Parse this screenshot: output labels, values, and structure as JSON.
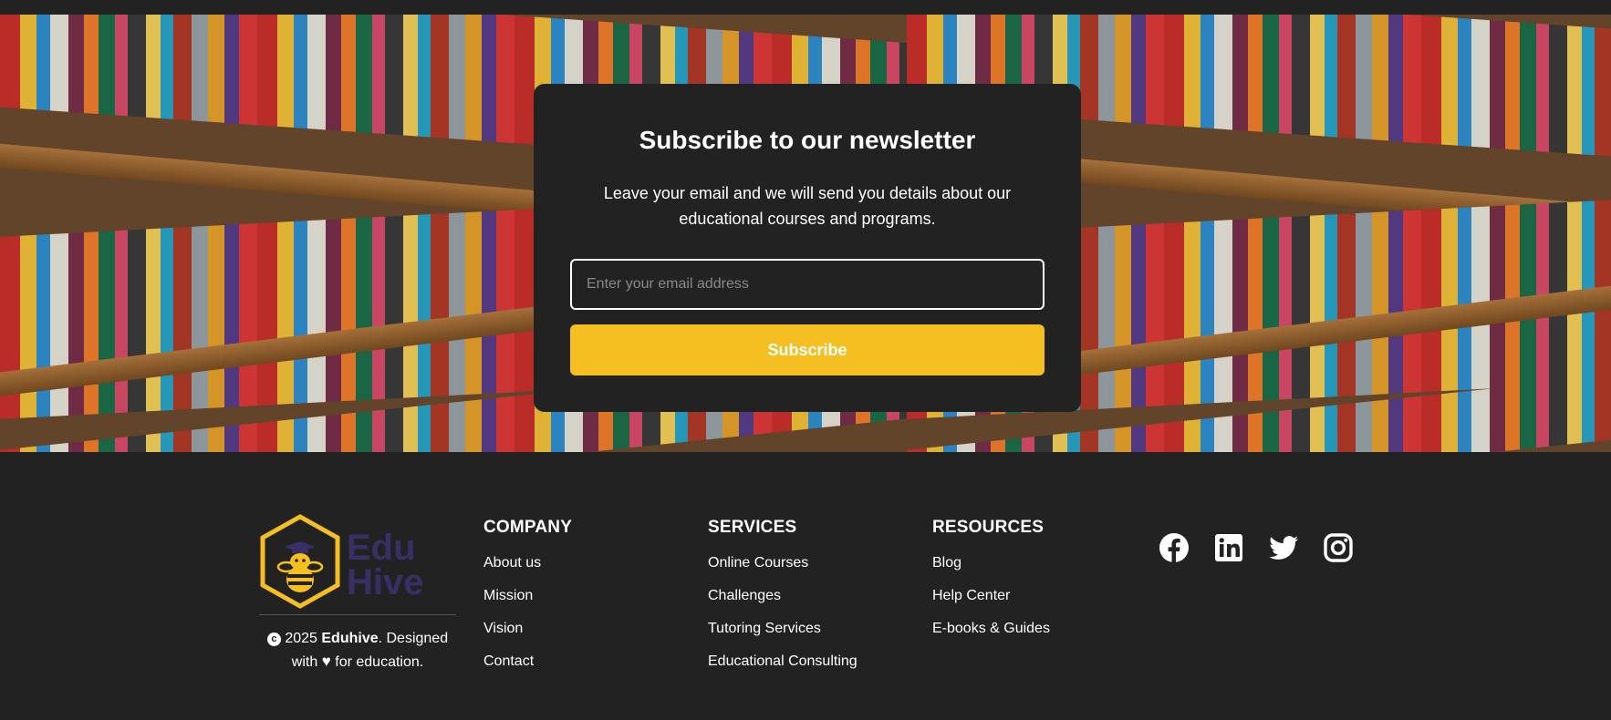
{
  "newsletter": {
    "title": "Subscribe to our newsletter",
    "description": "Leave your email and we will send you details about our educational courses and programs.",
    "email_placeholder": "Enter your email address",
    "button_label": "Subscribe"
  },
  "footer": {
    "brand": {
      "logo_text_line1": "Edu",
      "logo_text_line2": "Hive",
      "copyright_year": "2025",
      "copyright_name": "Eduhive",
      "copyright_suffix": ". Designed with",
      "copyright_end": "for education."
    },
    "columns": [
      {
        "title": "COMPANY",
        "links": [
          "About us",
          "Mission",
          "Vision",
          "Contact"
        ]
      },
      {
        "title": "SERVICES",
        "links": [
          "Online Courses",
          "Challenges",
          "Tutoring Services",
          "Educational Consulting"
        ]
      },
      {
        "title": "RESOURCES",
        "links": [
          "Blog",
          "Help Center",
          "E-books & Guides"
        ]
      }
    ],
    "social": [
      "facebook-icon",
      "linkedin-icon",
      "twitter-icon",
      "instagram-icon"
    ]
  },
  "colors": {
    "background": "#222222",
    "accent": "#f5bf21",
    "logo_text": "#3a2e66",
    "text": "#ffffff"
  }
}
